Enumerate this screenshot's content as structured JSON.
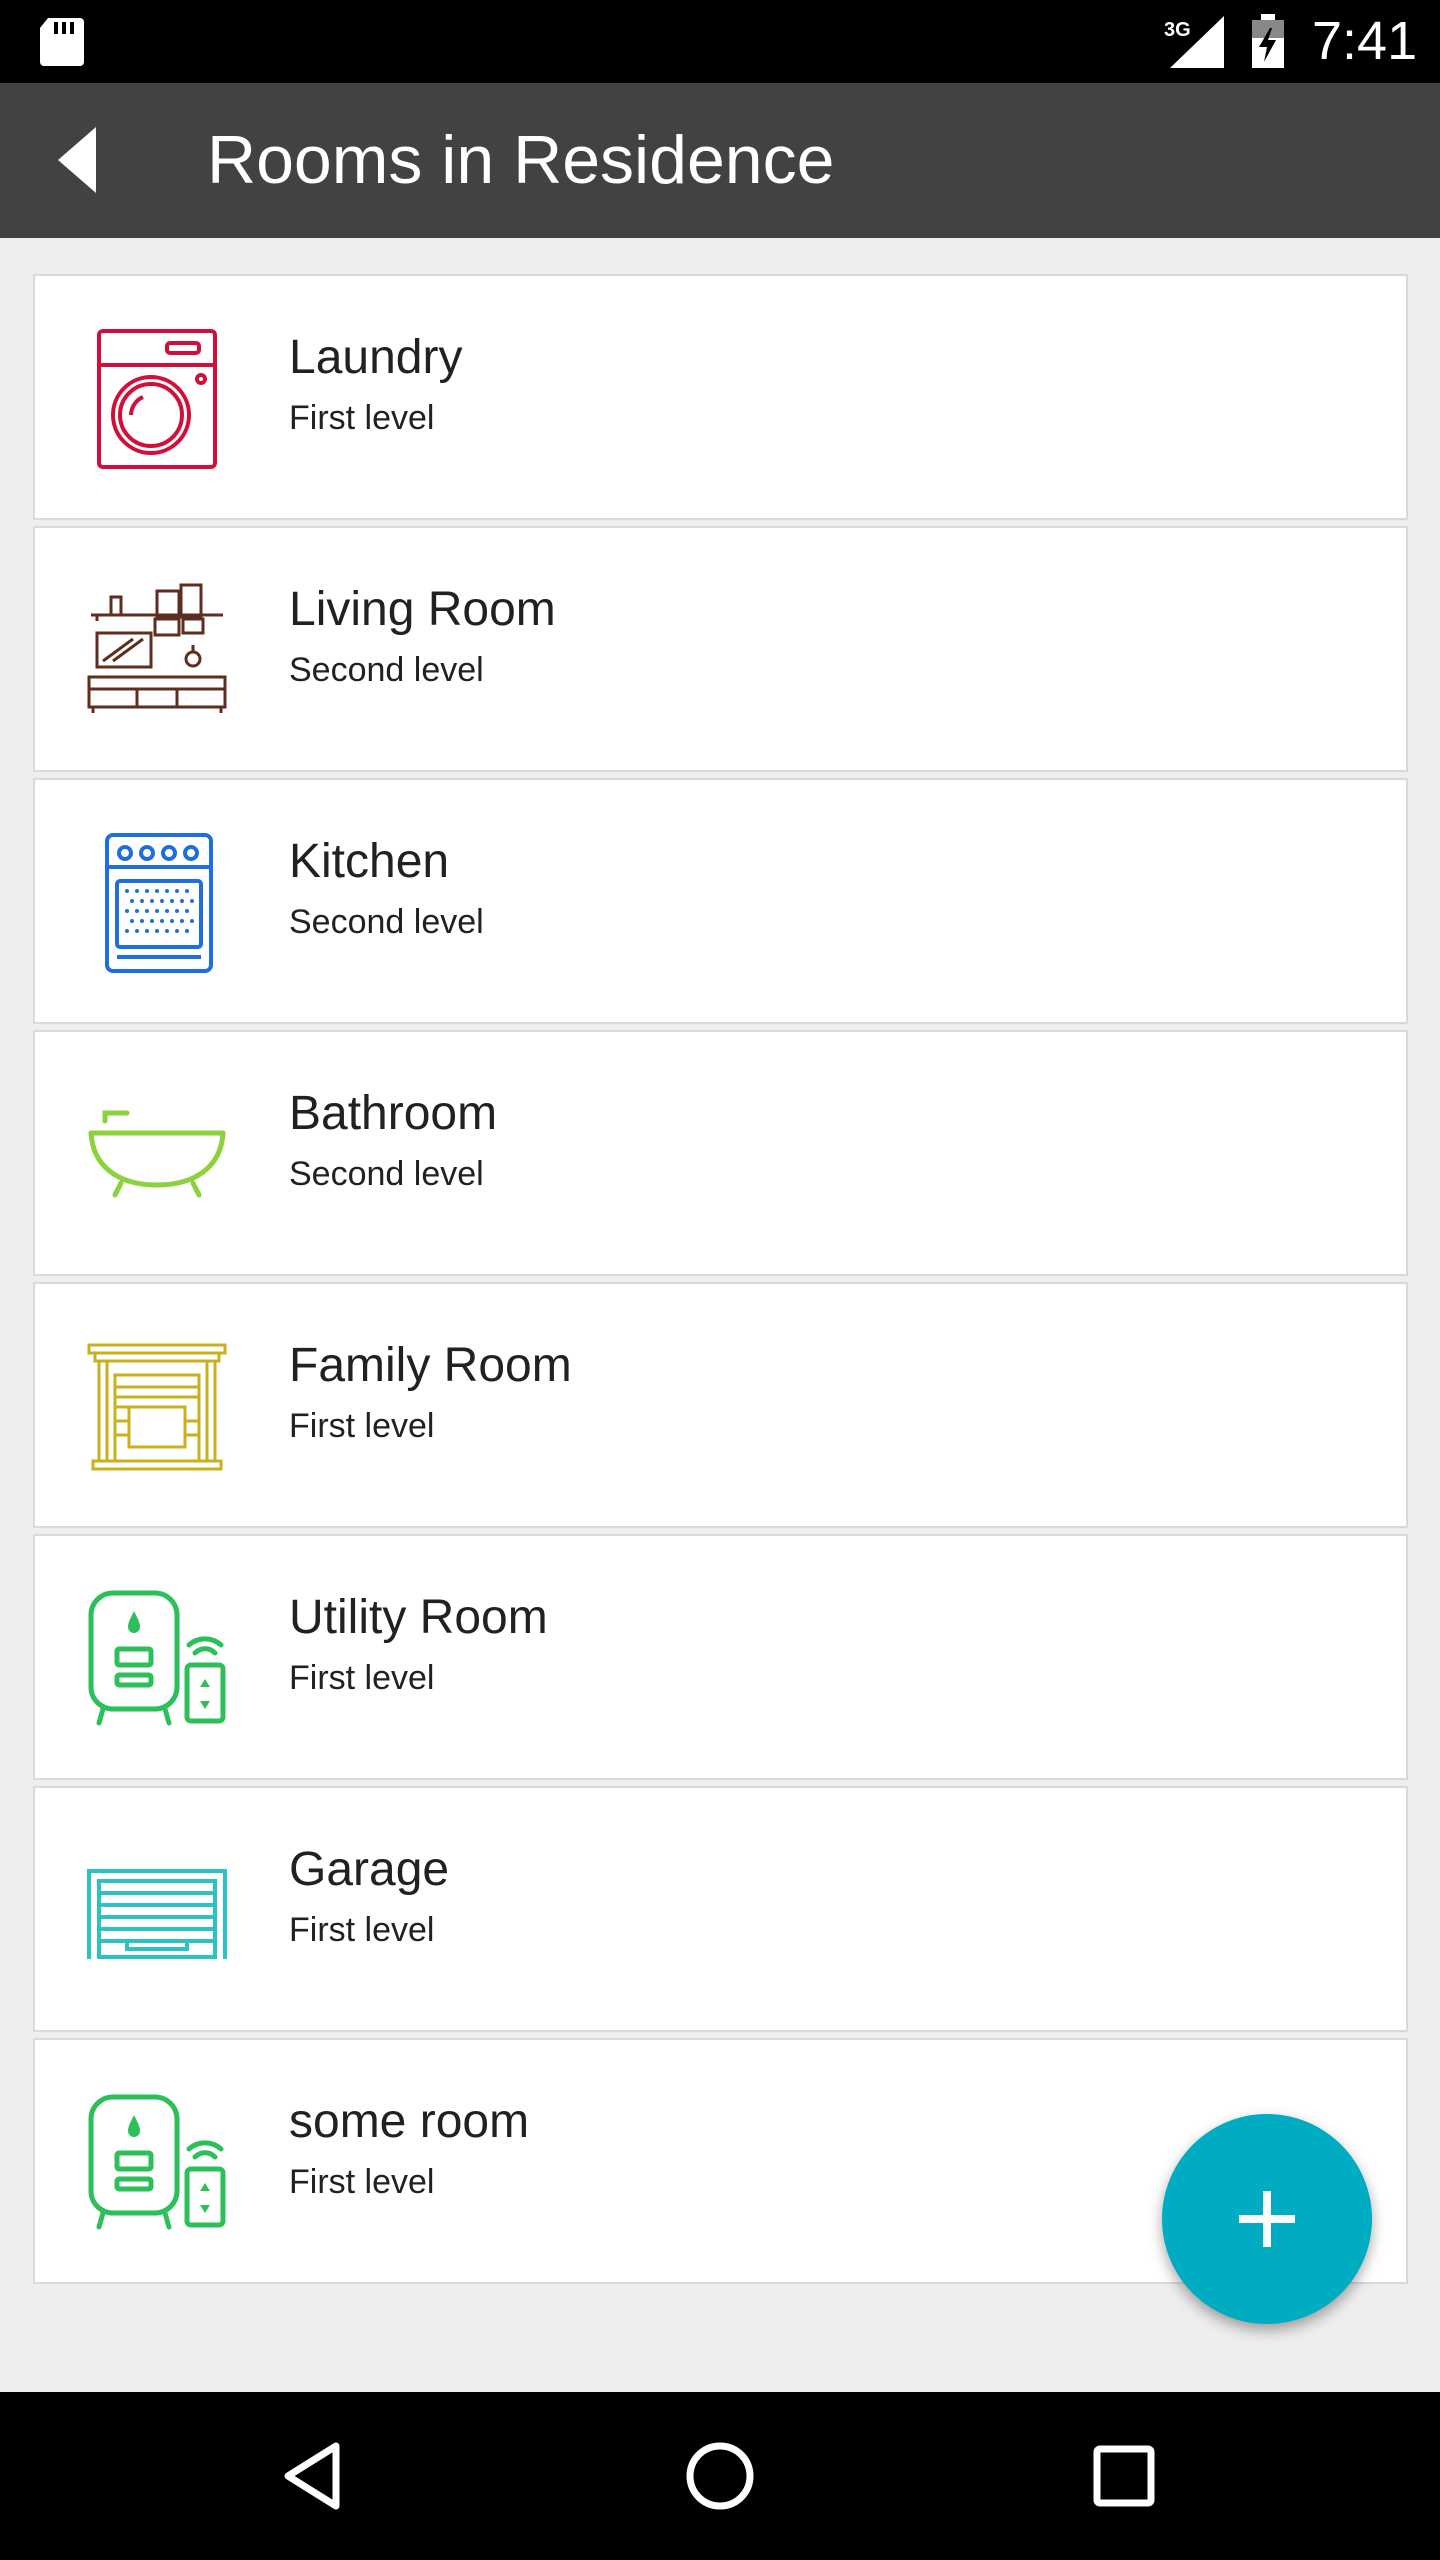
{
  "status_bar": {
    "network": "3G",
    "time": "7:41"
  },
  "app_bar": {
    "title": "Rooms in Residence",
    "back_icon": "back-arrow-icon"
  },
  "rooms": [
    {
      "name": "Laundry",
      "level": "First level",
      "icon": "washing-machine-icon",
      "color": "#d0103a"
    },
    {
      "name": "Living Room",
      "level": "Second level",
      "icon": "living-room-furniture-icon",
      "color": "#5d2e1f"
    },
    {
      "name": "Kitchen",
      "level": "Second level",
      "icon": "stove-oven-icon",
      "color": "#1e6fdc"
    },
    {
      "name": "Bathroom",
      "level": "Second level",
      "icon": "bathtub-icon",
      "color": "#8cd23c"
    },
    {
      "name": "Family Room",
      "level": "First level",
      "icon": "fireplace-icon",
      "color": "#c9b01c"
    },
    {
      "name": "Utility Room",
      "level": "First level",
      "icon": "water-heater-icon",
      "color": "#2dbf5a"
    },
    {
      "name": "Garage",
      "level": "First level",
      "icon": "garage-door-icon",
      "color": "#2dc2c2"
    },
    {
      "name": "some room",
      "level": "First level",
      "icon": "water-heater-icon",
      "color": "#2dbf5a"
    }
  ],
  "fab": {
    "icon": "plus-icon",
    "color": "#00acc1"
  },
  "nav_bar": {
    "back_icon": "nav-back-icon",
    "home_icon": "nav-home-icon",
    "recents_icon": "nav-recents-icon"
  }
}
